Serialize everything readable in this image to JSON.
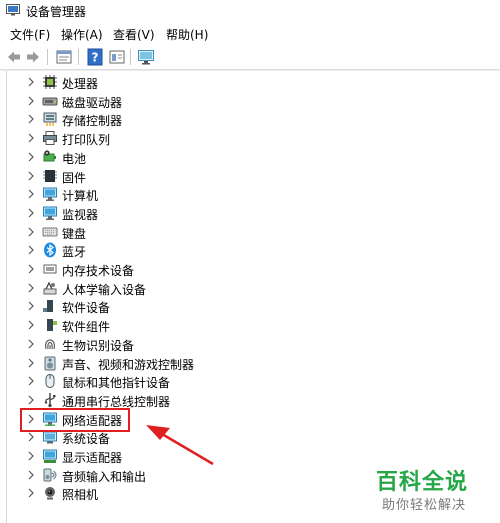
{
  "window": {
    "title": "设备管理器"
  },
  "menu": [
    "文件(F)",
    "操作(A)",
    "查看(V)",
    "帮助(H)"
  ],
  "toolbar": {
    "buttons": [
      "back-arrow-icon",
      "forward-arrow-icon",
      "properties-icon",
      "help-icon",
      "view-icon",
      "monitor-icon"
    ]
  },
  "tree": {
    "items": [
      {
        "label": "处理器",
        "icon": "processor-icon"
      },
      {
        "label": "磁盘驱动器",
        "icon": "disk-drive-icon"
      },
      {
        "label": "存储控制器",
        "icon": "storage-controller-icon"
      },
      {
        "label": "打印队列",
        "icon": "printer-icon"
      },
      {
        "label": "电池",
        "icon": "battery-icon"
      },
      {
        "label": "固件",
        "icon": "firmware-icon"
      },
      {
        "label": "计算机",
        "icon": "computer-icon"
      },
      {
        "label": "监视器",
        "icon": "monitor-icon"
      },
      {
        "label": "键盘",
        "icon": "keyboard-icon"
      },
      {
        "label": "蓝牙",
        "icon": "bluetooth-icon"
      },
      {
        "label": "内存技术设备",
        "icon": "memory-icon"
      },
      {
        "label": "人体学输入设备",
        "icon": "hid-icon"
      },
      {
        "label": "软件设备",
        "icon": "software-device-icon"
      },
      {
        "label": "软件组件",
        "icon": "software-component-icon"
      },
      {
        "label": "生物识别设备",
        "icon": "fingerprint-icon"
      },
      {
        "label": "声音、视频和游戏控制器",
        "icon": "speaker-icon"
      },
      {
        "label": "鼠标和其他指针设备",
        "icon": "mouse-icon"
      },
      {
        "label": "通用串行总线控制器",
        "icon": "usb-icon"
      },
      {
        "label": "网络适配器",
        "icon": "network-adapter-icon"
      },
      {
        "label": "系统设备",
        "icon": "system-device-icon"
      },
      {
        "label": "显示适配器",
        "icon": "display-adapter-icon"
      },
      {
        "label": "音频输入和输出",
        "icon": "audio-io-icon"
      },
      {
        "label": "照相机",
        "icon": "camera-icon"
      }
    ]
  },
  "annotation": {
    "highlighted_item": "网络适配器",
    "color": "#e02020"
  },
  "watermark": {
    "title": "百科全说",
    "subtitle": "助你轻松解决"
  }
}
